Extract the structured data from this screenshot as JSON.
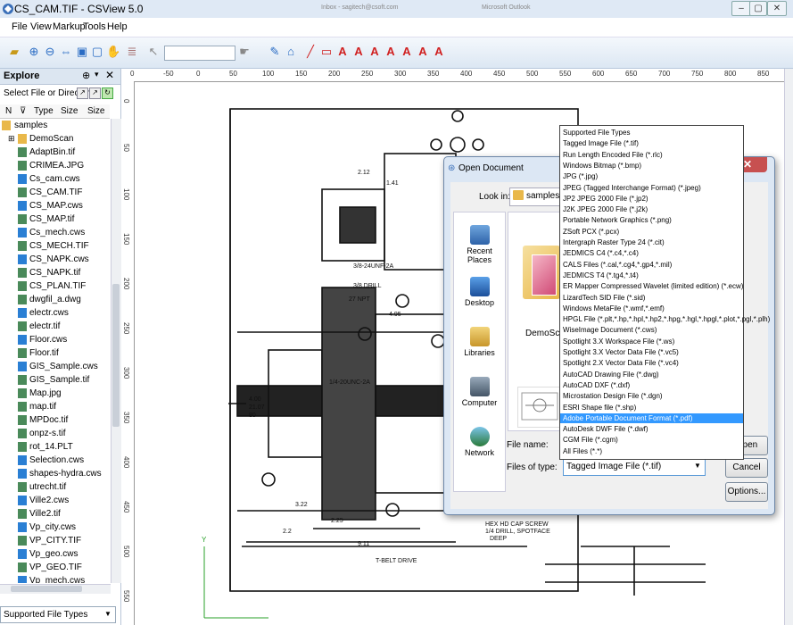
{
  "window": {
    "title": "CS_CAM.TIF - CSView 5.0",
    "bg_title_left": "Inbox - sagitech@csoft.com",
    "bg_title_right": "Microsoft Outlook"
  },
  "menu": [
    "File",
    "View",
    "Markup",
    "Tools",
    "Help"
  ],
  "explore": {
    "title": "Explore",
    "select_label": "Select File or Directory",
    "columns": [
      "N",
      "Type",
      "Size",
      "Size"
    ],
    "root": "samples",
    "items": [
      "DemoScan",
      "AdaptBin.tif",
      "CRIMEA.JPG",
      "Cs_cam.cws",
      "CS_CAM.TIF",
      "CS_MAP.cws",
      "CS_MAP.tif",
      "Cs_mech.cws",
      "CS_MECH.TIF",
      "CS_NAPK.cws",
      "CS_NAPK.tif",
      "CS_PLAN.TIF",
      "dwgfil_a.dwg",
      "electr.cws",
      "electr.tif",
      "Floor.cws",
      "Floor.tif",
      "GIS_Sample.cws",
      "GIS_Sample.tif",
      "Map.jpg",
      "map.tif",
      "MPDoc.tif",
      "onpz-s.tif",
      "rot_14.PLT",
      "Selection.cws",
      "shapes-hydra.cws",
      "utrecht.tif",
      "Ville2.cws",
      "Ville2.tif",
      "Vp_city.cws",
      "VP_CITY.TIF",
      "Vp_geo.cws",
      "VP_GEO.TIF",
      "Vp_mech.cws"
    ],
    "filetype": "Supported File Types"
  },
  "ruler": {
    "h": [
      "0",
      "-50",
      "0",
      "50",
      "100",
      "150",
      "200",
      "250",
      "300",
      "350",
      "400",
      "450",
      "500",
      "550",
      "600",
      "650",
      "700",
      "750",
      "800",
      "850",
      "900"
    ],
    "v": [
      "0",
      "50",
      "100",
      "150",
      "200",
      "250",
      "300",
      "350",
      "400",
      "450",
      "500",
      "550"
    ]
  },
  "dialog": {
    "title": "Open Document",
    "look_in_label": "Look in:",
    "look_in_value": "samples",
    "places": [
      "Recent Places",
      "Desktop",
      "Libraries",
      "Computer",
      "Network"
    ],
    "folder_name": "DemoScan",
    "file_name_label": "File name:",
    "files_of_type_label": "Files of type:",
    "files_of_type_value": "Tagged Image File (*.tif)",
    "open_label": "Open",
    "cancel_label": "Cancel",
    "options_label": "Options..."
  },
  "file_types": [
    "Supported File Types",
    "Tagged Image File (*.tif)",
    "Run Length Encoded File (*.rlc)",
    "Windows Bitmap (*.bmp)",
    "JPG (*.jpg)",
    "JPEG (Tagged Interchange Format) (*.jpeg)",
    "JP2 JPEG 2000 File (*.jp2)",
    "J2K JPEG 2000 File (*.j2k)",
    "Portable Network Graphics (*.png)",
    "ZSoft PCX (*.pcx)",
    "Intergraph Raster Type 24 (*.cit)",
    "JEDMICS C4 (*.c4,*.c4)",
    "CALS Files (*.cal,*.cg4,*.gp4,*.mil)",
    "JEDMICS T4 (*.tg4,*.t4)",
    "ER Mapper Compressed Wavelet (limited edition) (*.ecw)",
    "LizardTech SID File (*.sid)",
    "Windows MetaFile (*.wmf,*.emf)",
    "HPGL File (*.plt,*.hp,*.hpl,*.hp2,*.hpg,*.hgl,*.hpgl,*.plot,*.pgl,*.plh)",
    "WiseImage Document (*.cws)",
    "Spotlight 3.X Workspace File (*.ws)",
    "Spotlight 3.X Vector Data File (*.vc5)",
    "Spotlight 2.X Vector Data File (*.vc4)",
    "AutoCAD Drawing File (*.dwg)",
    "AutoCAD DXF (*.dxf)",
    "Microstation Design File (*.dgn)",
    "ESRI Shape file (*.shp)",
    "Adobe Portable Document Format (*.pdf)",
    "AutoDesk DWF File (*.dwf)",
    "CGM File (*.cgm)",
    "All Files (*.*)"
  ],
  "selected_type_index": 26,
  "drawing": {
    "dims": [
      "2.12",
      "1.41",
      "3/8-24UNF-2A",
      "3/8 DRILL",
      "27 NPT",
      "4.95",
      "1/4-20UNC-2A",
      "3.22",
      "2.25",
      "2.2",
      "9.11",
      "4.00",
      "21.07",
      "80",
      "T-BELT DRIVE",
      "1/4 DRILL, SPOTFACE",
      "DEEP",
      "HEX HD CAP SCREW"
    ],
    "balloons": [
      "100",
      "100",
      "100",
      "100",
      "100",
      "103",
      "104",
      "105"
    ]
  },
  "colors": {
    "accent": "#3399ff",
    "titlebar": "#dfe9f5",
    "close": "#c75050",
    "panel": "#dce6f1"
  }
}
